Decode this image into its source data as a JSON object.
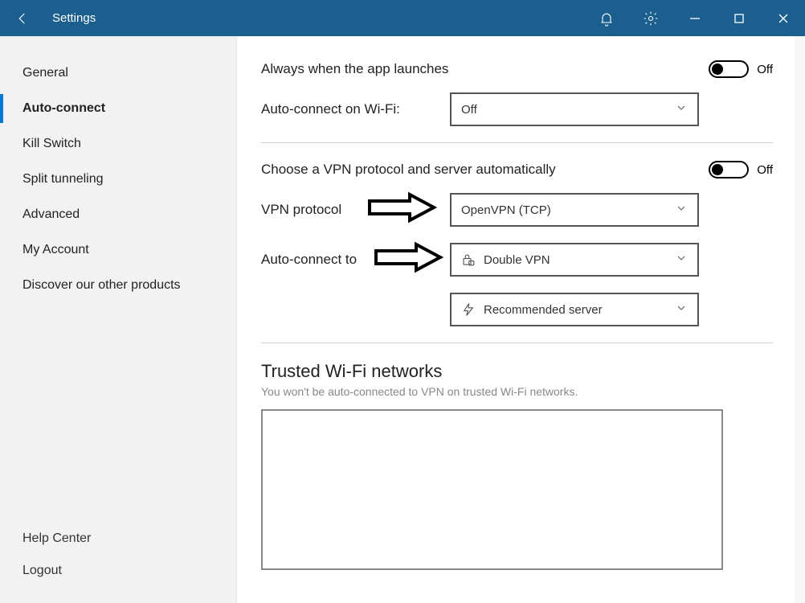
{
  "header": {
    "title": "Settings"
  },
  "sidebar": {
    "items": [
      {
        "label": "General"
      },
      {
        "label": "Auto-connect"
      },
      {
        "label": "Kill Switch"
      },
      {
        "label": "Split tunneling"
      },
      {
        "label": "Advanced"
      },
      {
        "label": "My Account"
      },
      {
        "label": "Discover our other products"
      }
    ],
    "footer": [
      {
        "label": "Help Center"
      },
      {
        "label": "Logout"
      }
    ]
  },
  "main": {
    "alwaysLaunch": {
      "label": "Always when the app launches",
      "state": "Off"
    },
    "wifi": {
      "label": "Auto-connect on Wi-Fi:",
      "value": "Off"
    },
    "autoProtocol": {
      "label": "Choose a VPN protocol and server automatically",
      "state": "Off"
    },
    "protocol": {
      "label": "VPN protocol",
      "value": "OpenVPN (TCP)"
    },
    "connectTo": {
      "label": "Auto-connect to",
      "value": "Double VPN"
    },
    "server": {
      "value": "Recommended server"
    },
    "trusted": {
      "title": "Trusted Wi-Fi networks",
      "subtitle": "You won't be auto-connected to VPN on trusted Wi-Fi networks."
    }
  }
}
